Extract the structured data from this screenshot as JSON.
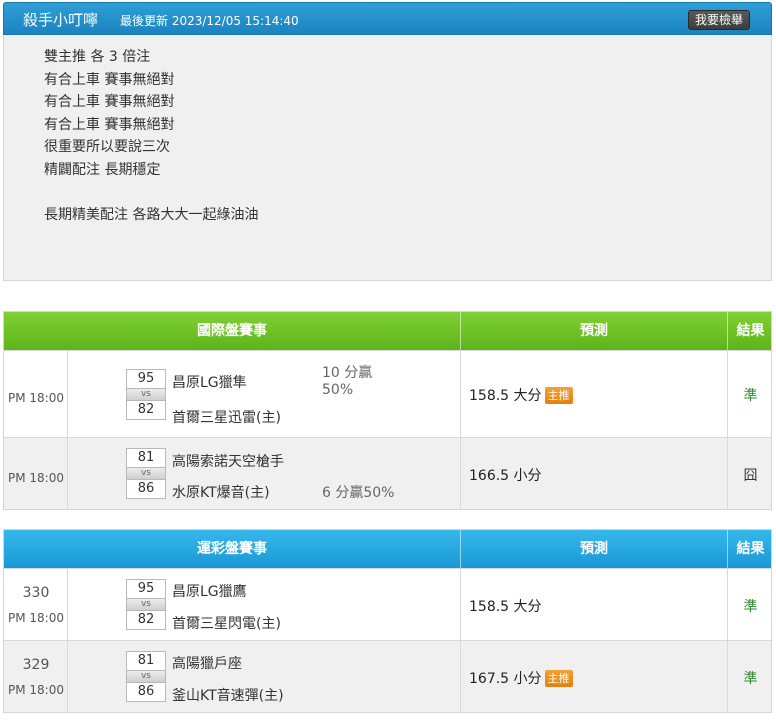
{
  "header": {
    "expert_name": "殺手小叮嚀",
    "updated": "最後更新 2023/12/05 15:14:40",
    "report_button": "我要檢舉"
  },
  "notes": [
    "雙主推 各 3 倍注",
    "有合上車 賽事無絕對",
    "有合上車 賽事無絕對",
    "有合上車 賽事無絕對",
    "很重要所以要說三次",
    "精闢配注 長期穩定",
    "",
    "長期精美配注 各路大大一起綠油油"
  ],
  "intl": {
    "headers": {
      "match": "國際盤賽事",
      "prediction": "預測",
      "result": "結果"
    },
    "rows": [
      {
        "time": "PM 18:00",
        "score1": "95",
        "vs": "vs",
        "score2": "82",
        "team1": "昌原LG獵隼",
        "team2": "首爾三星迅雷(主)",
        "hcap1": "10 分贏",
        "hcap2": "50%",
        "prediction": "158.5 大分",
        "badge": "主推",
        "result": "準"
      },
      {
        "time": "PM 18:00",
        "score1": "81",
        "vs": "vs",
        "score2": "86",
        "team1": "高陽索諾天空槍手",
        "team2": "水原KT爆音(主)",
        "hcap1": "6 分贏50%",
        "prediction": "166.5 小分",
        "result": "囧"
      }
    ]
  },
  "lottery": {
    "headers": {
      "match": "運彩盤賽事",
      "prediction": "預測",
      "result": "結果"
    },
    "rows": [
      {
        "game_no": "330",
        "time": "PM 18:00",
        "score1": "95",
        "vs": "vs",
        "score2": "82",
        "team1": "昌原LG獵鷹",
        "team2": "首爾三星閃電(主)",
        "prediction": "158.5 大分",
        "result": "準"
      },
      {
        "game_no": "329",
        "time": "PM 18:00",
        "score1": "81",
        "vs": "vs",
        "score2": "86",
        "team1": "高陽獵戶座",
        "team2": "釜山KT音速彈(主)",
        "prediction": "167.5 小分",
        "badge": "主推",
        "result": "準"
      }
    ]
  }
}
